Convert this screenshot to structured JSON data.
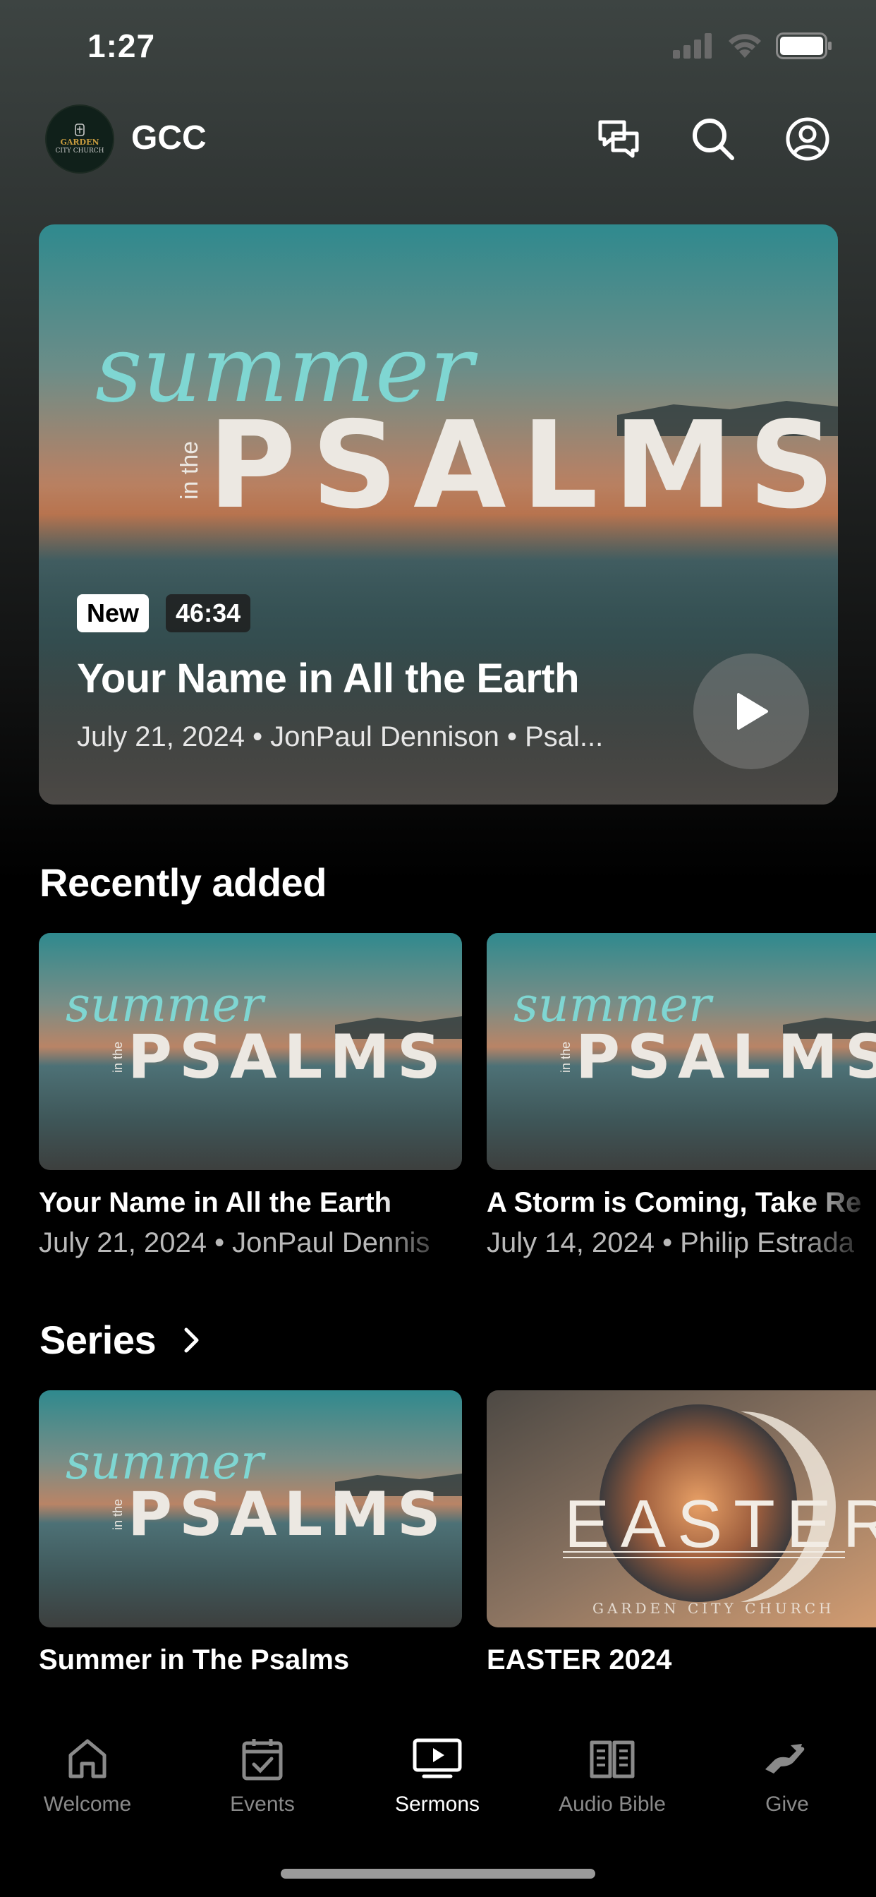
{
  "status_bar": {
    "time": "1:27"
  },
  "header": {
    "title": "GCC",
    "logo_text_top": "GARDEN",
    "logo_text_bottom": "CITY CHURCH",
    "actions": [
      "chat-icon",
      "search-icon",
      "account-icon"
    ]
  },
  "hero": {
    "badge_new": "New",
    "duration": "46:34",
    "title": "Your Name in All the Earth",
    "meta": "July 21, 2024 • JonPaul Dennison • Psal...",
    "art_script": "summer",
    "art_small": "in the",
    "art_big": "PSALMS"
  },
  "recently_added": {
    "heading": "Recently added",
    "items": [
      {
        "title": "Your Name in All the Earth",
        "meta": "July 21, 2024 • JonPaul Dennis"
      },
      {
        "title": "A Storm is Coming, Take Re",
        "meta": "July 14, 2024 • Philip Estrada"
      }
    ]
  },
  "series": {
    "heading": "Series",
    "items": [
      {
        "title": "Summer in The Psalms"
      },
      {
        "title": "EASTER 2024",
        "art_big": "EASTER",
        "art_sub": "GARDEN CITY CHURCH"
      }
    ]
  },
  "tab_bar": {
    "tabs": [
      {
        "label": "Welcome",
        "icon": "home-icon",
        "active": false
      },
      {
        "label": "Events",
        "icon": "calendar-icon",
        "active": false
      },
      {
        "label": "Sermons",
        "icon": "tv-play-icon",
        "active": true
      },
      {
        "label": "Audio Bible",
        "icon": "open-book-icon",
        "active": false
      },
      {
        "label": "Give",
        "icon": "giving-hand-icon",
        "active": false
      }
    ]
  },
  "colors": {
    "background": "#000000",
    "accent_teal": "#7fd6d2",
    "muted_text": "#8a8a8a"
  }
}
